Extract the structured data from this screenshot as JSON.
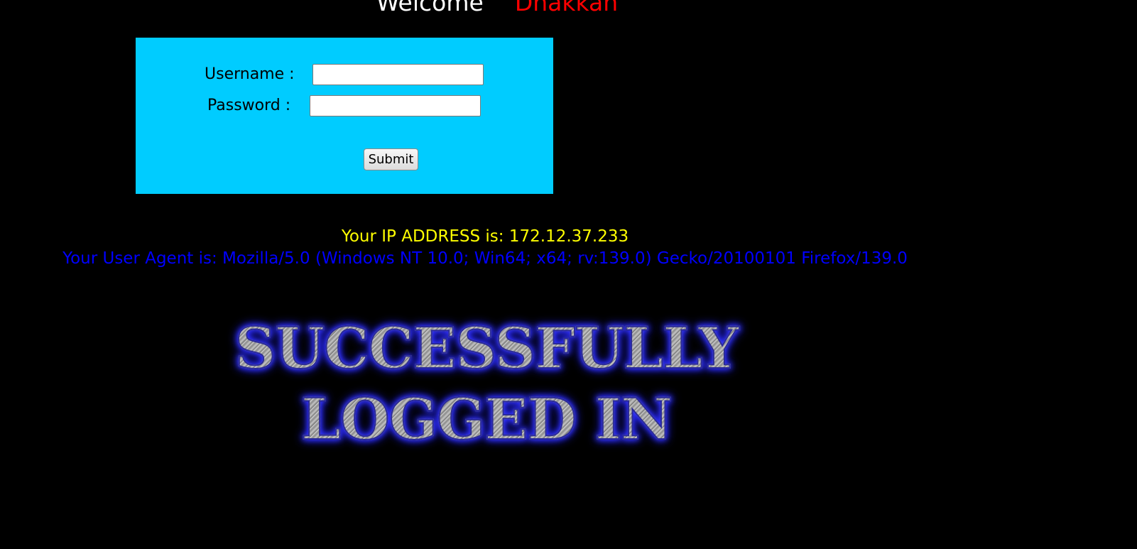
{
  "header": {
    "welcome_word": "Welcome",
    "user_name": "Dhakkan"
  },
  "login_form": {
    "username_label": "Username :",
    "username_value": "",
    "password_label": "Password :",
    "password_value": "",
    "submit_label": "Submit"
  },
  "info": {
    "ip_text": "Your IP ADDRESS is: 172.12.37.233",
    "user_agent_text": "Your User Agent is: Mozilla/5.0 (Windows NT 10.0; Win64; x64; rv:139.0) Gecko/20100101 Firefox/139.0"
  },
  "banner": {
    "line1": "SUCCESSFULLY",
    "line2": "LOGGED IN"
  },
  "colors": {
    "background": "#000000",
    "form_background": "#00ccff",
    "welcome": "#ffffff",
    "name": "#ff0000",
    "ip_text": "#ffff00",
    "user_agent_text": "#0000ff"
  }
}
